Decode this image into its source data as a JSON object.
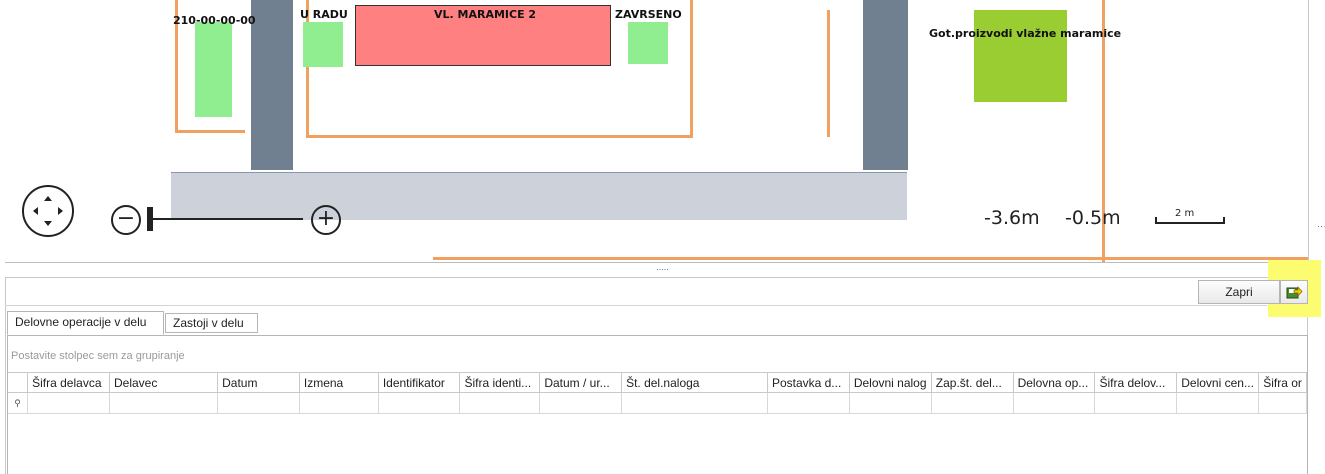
{
  "map": {
    "labels": {
      "item_code": "210-00-00-00",
      "status_in_progress": "U RADU",
      "machine_name": "VL. MARAMICE 2",
      "status_done": "ZAVRSENO",
      "finished_goods": "Got.proizvodi vlažne maramice"
    },
    "coord_x": "-3.6m",
    "coord_y": "-0.5m",
    "scale_label": "2 m",
    "zoom_out_glyph": "−",
    "zoom_in_glyph": "+",
    "colors": {
      "machine": "#ff8080",
      "station": "#90ee90",
      "storage": "#9acd32",
      "pillar": "#708090",
      "floor": "#ccd1da",
      "wall": "#f0a060"
    }
  },
  "splitter": {
    "grip": "....."
  },
  "toolbar": {
    "close_label": "Zapri",
    "export_icon": "export-icon",
    "highlight_color": "#fcfc70"
  },
  "tabs": [
    {
      "label": "Delovne operacije  v delu",
      "active": true
    },
    {
      "label": "Zastoji v delu",
      "active": false
    }
  ],
  "grid": {
    "group_panel_hint": "Postavite stolpec sem za grupiranje",
    "filter_row_icon": "filter-pin-icon",
    "columns": [
      "Šifra delavca",
      "Delavec",
      "Datum",
      "Izmena",
      "Identifikator",
      "Šifra identi...",
      "Datum / ur...",
      "Št. del.naloga",
      "Postavka d...",
      "Delovni nalog",
      "Zap.št. del...",
      "Delovna op...",
      "Šifra delov...",
      "Delovni cen...",
      "Šifra or"
    ]
  }
}
